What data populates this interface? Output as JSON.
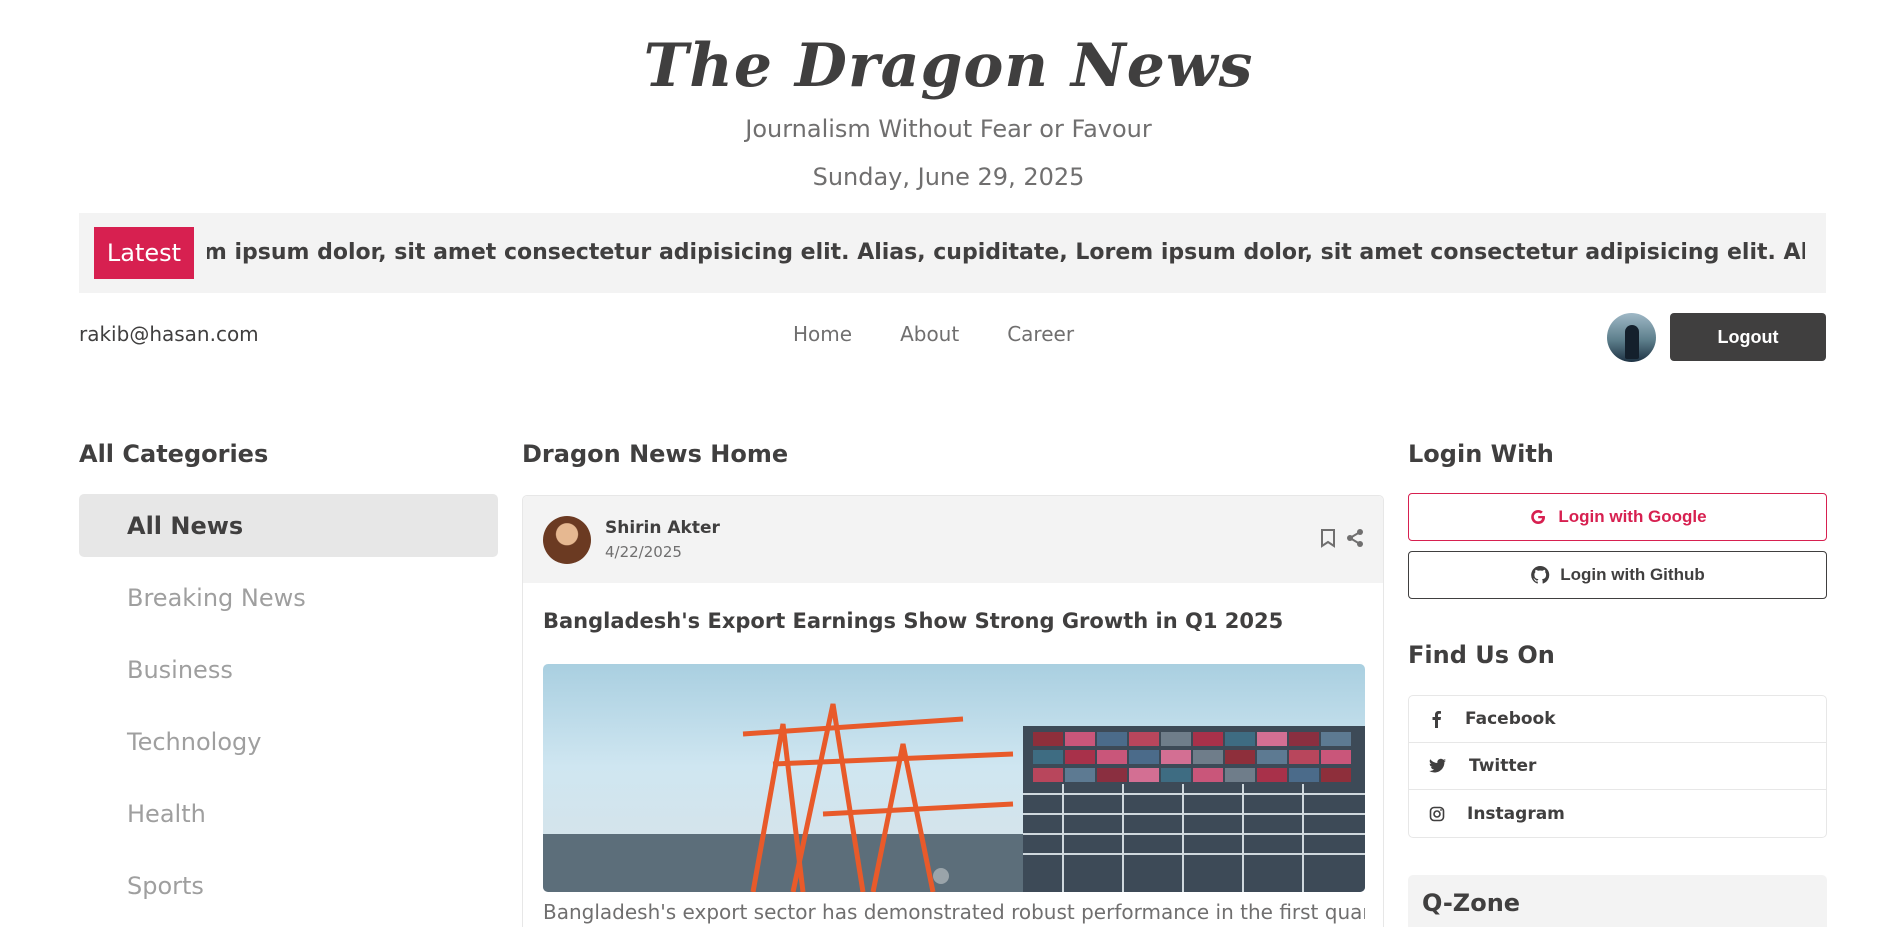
{
  "header": {
    "logo": "The Dragon News",
    "tagline": "Journalism Without Fear or Favour",
    "date": "Sunday, June 29, 2025"
  },
  "ticker": {
    "badge": "Latest",
    "text": "Lorem ipsum dolor, sit amet consectetur adipisicing elit. Alias, cupiditate, Lorem ipsum dolor, sit amet consectetur adipisicing elit. Alias, cupiditate!   Lorem ipsum dolor, sit amet"
  },
  "navbar": {
    "email": "rakib@hasan.com",
    "links": [
      "Home",
      "About",
      "Career"
    ],
    "logout": "Logout"
  },
  "left": {
    "title": "All Categories",
    "categories": [
      "All News",
      "Breaking News",
      "Business",
      "Technology",
      "Health",
      "Sports"
    ]
  },
  "main": {
    "title": "Dragon News Home",
    "card": {
      "author": "Shirin Akter",
      "date": "4/22/2025",
      "headline": "Bangladesh's Export Earnings Show Strong Growth in Q1 2025",
      "excerpt": "Bangladesh's export sector has demonstrated robust performance in the first quarter"
    }
  },
  "right": {
    "login_title": "Login With",
    "google": "Login with Google",
    "github": "Login with Github",
    "find_title": "Find Us On",
    "social": [
      "Facebook",
      "Twitter",
      "Instagram"
    ],
    "qzone": "Q-Zone"
  },
  "colors": {
    "accent": "#d72050",
    "dark": "#403f3f",
    "muted": "#706f6f",
    "panel": "#f3f3f3"
  }
}
